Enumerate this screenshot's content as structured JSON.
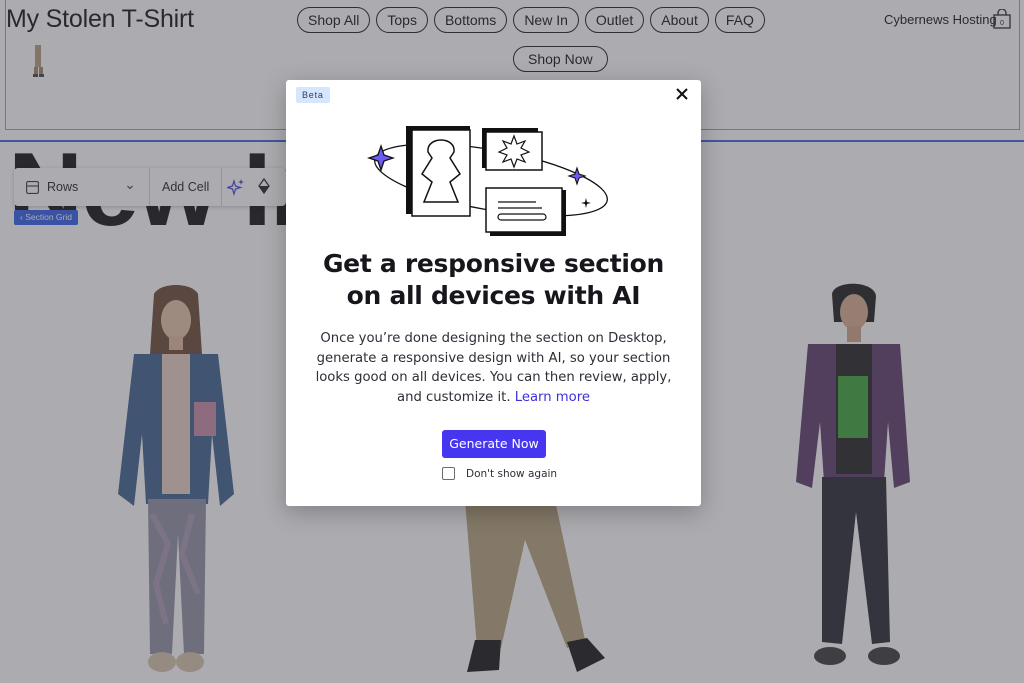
{
  "site": {
    "title": "My Stolen T-Shirt",
    "nav": [
      "Shop All",
      "Tops",
      "Bottoms",
      "New In",
      "Outlet",
      "About",
      "FAQ"
    ],
    "shop_now": "Shop Now",
    "brand": "Cybernews Hosting",
    "heading": "New In"
  },
  "toolbar": {
    "rows_label": "Rows",
    "add_cell_label": "Add Cell"
  },
  "section_tag": "‹ Section Grid",
  "modal": {
    "badge": "Beta",
    "title": "Get a responsive section on all devices with AI",
    "body": "Once you’re done designing the section on Desktop, generate a responsive design with AI, so your section looks good on all devices. You can then review, apply, and customize it.",
    "learn_more": "Learn more",
    "primary_button": "Generate Now",
    "checkbox_label": "Don't show again",
    "checkbox_checked": false
  },
  "colors": {
    "accent": "#4636f0",
    "link": "#3f2fe0",
    "badge_bg": "#d6e6fe",
    "selection": "#2f5bea"
  },
  "icons": {
    "close": "close-icon",
    "bag": "shopping-bag-icon",
    "rows": "rows-layout-icon",
    "ai": "sparkle-ai-icon",
    "design": "design-drop-icon"
  }
}
